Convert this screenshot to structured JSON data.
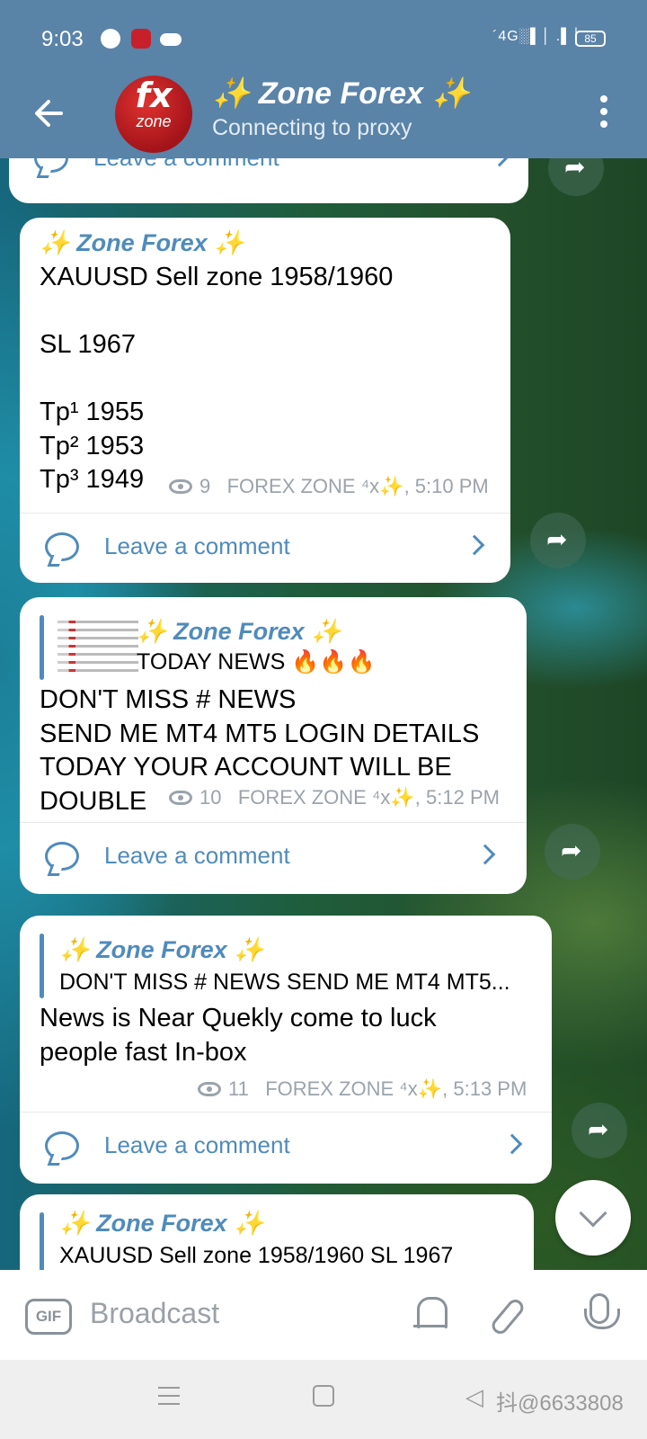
{
  "status_bar": {
    "time": "9:03",
    "signal": "´4G░▌│ .▌│",
    "battery": "85"
  },
  "header": {
    "avatar_top": "fx",
    "avatar_bottom": "zone",
    "title": "✨ Zone Forex ✨",
    "subtitle": "Connecting to proxy"
  },
  "messages": [
    {
      "comment_label": "Leave a comment"
    },
    {
      "sender": "✨ Zone Forex ✨",
      "text": "XAUUSD Sell zone 1958/1960\n\nSL 1967\n\nTp¹ 1955\nTp² 1953\nTp³ 1949",
      "views": "9",
      "author_time": "FOREX ZONE ⁴x✨, 5:10 PM",
      "comment_label": "Leave a comment"
    },
    {
      "reply_title": "✨ Zone Forex ✨",
      "reply_text": "TODAY NEWS 🔥🔥🔥",
      "text": "DON'T MISS # NEWS\nSEND ME MT4 MT5 LOGIN DETAILS\nTODAY YOUR ACCOUNT WILL BE\nDOUBLE",
      "views": "10",
      "author_time": "FOREX ZONE ⁴x✨, 5:12 PM",
      "comment_label": "Leave a comment"
    },
    {
      "reply_title": "✨ Zone Forex ✨",
      "reply_text": "DON'T MISS # NEWS SEND ME MT4 MT5...",
      "text": "News is Near Quekly come to luck\npeople fast In-box",
      "views": "11",
      "author_time": "FOREX ZONE ⁴x✨, 5:13 PM",
      "comment_label": "Leave a comment"
    },
    {
      "reply_title": "✨ Zone Forex ✨",
      "reply_text": "XAUUSD Sell zone 1958/1960  SL 1967"
    }
  ],
  "input_bar": {
    "gif_label": "GIF",
    "placeholder": "Broadcast"
  },
  "watermark": "抖@6633808",
  "icons": [
    "back-arrow-icon",
    "more-vert-icon",
    "eye-icon",
    "comment-icon",
    "chevron-right-icon",
    "share-icon",
    "chevron-down-icon",
    "gif-icon",
    "bell-icon",
    "paperclip-icon",
    "mic-icon"
  ],
  "colors": {
    "header": "#5a83a8",
    "accent": "#4f8bbb",
    "meta": "#9aa3ab"
  }
}
